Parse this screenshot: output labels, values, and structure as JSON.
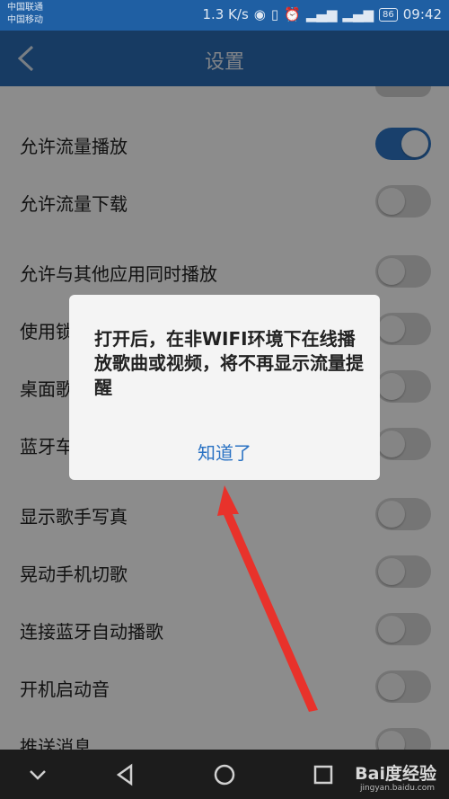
{
  "status_bar": {
    "carrier_1": "中国联通",
    "carrier_2": "中国移动",
    "speed": "1.3 K/s",
    "battery": "86",
    "time": "09:42"
  },
  "header": {
    "title": "设置"
  },
  "settings": [
    {
      "label": "允许流量播放",
      "on": true
    },
    {
      "label": "允许流量下载",
      "on": false
    },
    {
      "label": "允许与其他应用同时播放",
      "on": false
    },
    {
      "label": "使用锁屏",
      "on": false
    },
    {
      "label": "桌面歌词",
      "on": false
    },
    {
      "label": "蓝牙车载歌词",
      "on": false
    },
    {
      "label": "显示歌手写真",
      "on": false
    },
    {
      "label": "晃动手机切歌",
      "on": false
    },
    {
      "label": "连接蓝牙自动播歌",
      "on": false
    },
    {
      "label": "开机启动音",
      "on": false
    },
    {
      "label": "推送消息",
      "on": false
    }
  ],
  "dialog": {
    "message": "打开后，在非WIFI环境下在线播放歌曲或视频，将不再显示流量提醒",
    "button": "知道了"
  },
  "annotation": {
    "arrow_color": "#e8322b"
  },
  "watermark": {
    "brand": "Bai度经验",
    "site": "jingyan.baidu.com"
  }
}
